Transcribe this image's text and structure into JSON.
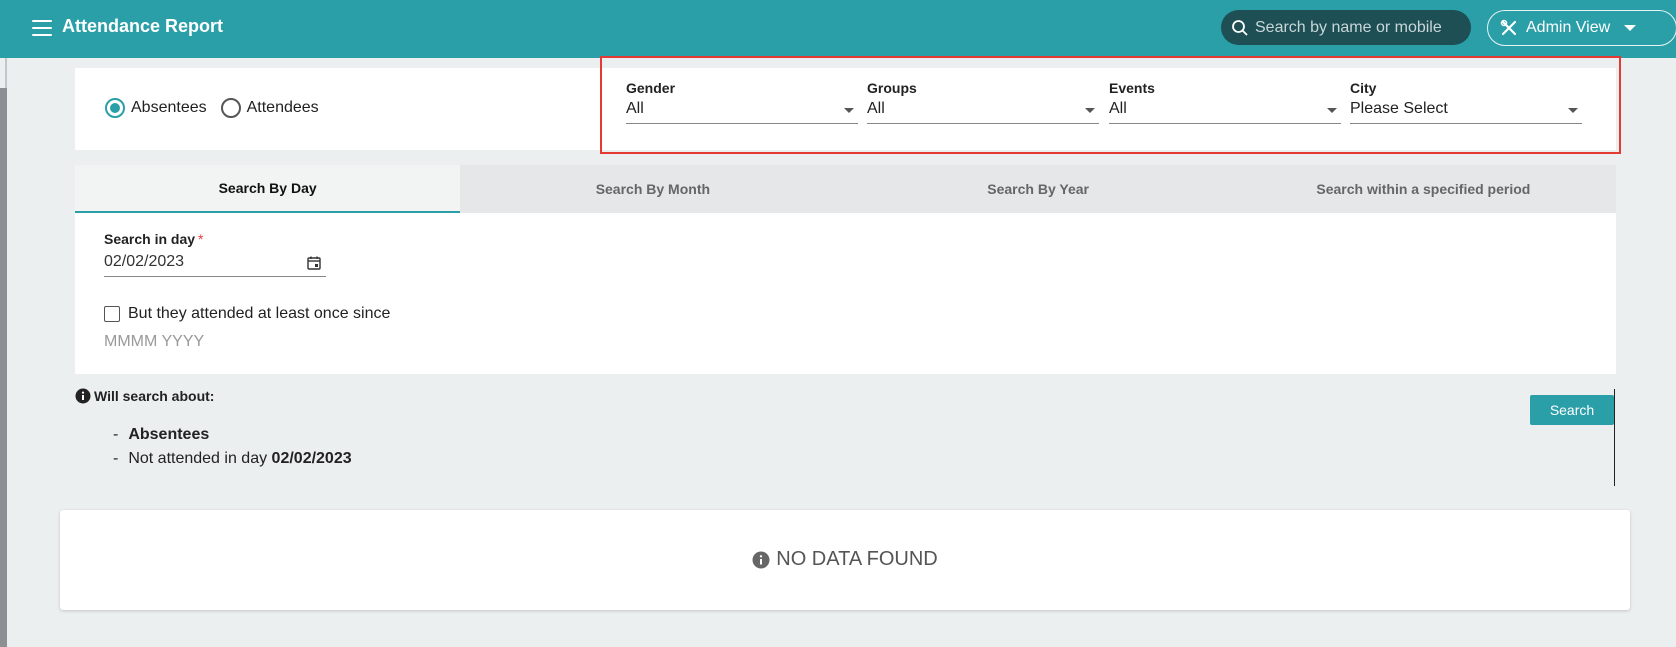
{
  "header": {
    "title": "Attendance Report",
    "search_placeholder": "Search by name or mobile",
    "admin_label": "Admin View"
  },
  "filters": {
    "radio": {
      "absentees": "Absentees",
      "attendees": "Attendees",
      "selected": "Absentees"
    },
    "gender": {
      "label": "Gender",
      "value": "All"
    },
    "groups": {
      "label": "Groups",
      "value": "All"
    },
    "events": {
      "label": "Events",
      "value": "All"
    },
    "city": {
      "label": "City",
      "value": "Please Select"
    }
  },
  "tabs": [
    {
      "label": "Search By Day",
      "active": true
    },
    {
      "label": "Search By Month",
      "active": false
    },
    {
      "label": "Search By Year",
      "active": false
    },
    {
      "label": "Search within a specified period",
      "active": false
    }
  ],
  "day_panel": {
    "label": "Search in day",
    "required_mark": "*",
    "date_value": "02/02/2023",
    "checkbox_label": "But they attended at least once since",
    "month_placeholder": "MMMM YYYY"
  },
  "info": {
    "title": "Will search about:",
    "bullet1": "Absentees",
    "bullet2_prefix": "Not attended in day",
    "bullet2_date": "02/02/2023"
  },
  "search_button": "Search",
  "no_data": "NO DATA FOUND",
  "colors": {
    "primary": "#2b9fa8",
    "highlight_border": "#e53935",
    "background": "#eceff0"
  }
}
